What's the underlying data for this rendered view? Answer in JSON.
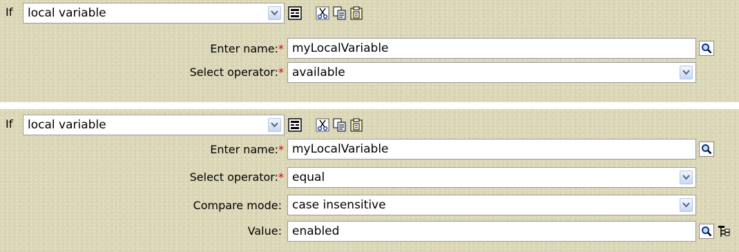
{
  "conditions": [
    {
      "if_label": "If",
      "type_select": "local variable",
      "fields": {
        "name_label": "Enter name:",
        "name_value": "myLocalVariable",
        "operator_label": "Select operator:",
        "operator_value": "available"
      }
    },
    {
      "if_label": "If",
      "type_select": "local variable",
      "fields": {
        "name_label": "Enter name:",
        "name_value": "myLocalVariable",
        "operator_label": "Select operator:",
        "operator_value": "equal",
        "compare_label": "Compare mode:",
        "compare_value": "case insensitive",
        "value_label": "Value:",
        "value_value": "enabled"
      }
    }
  ],
  "required_marker": "*",
  "colors": {
    "panel": "#dbd6b6",
    "required": "#d00000"
  }
}
